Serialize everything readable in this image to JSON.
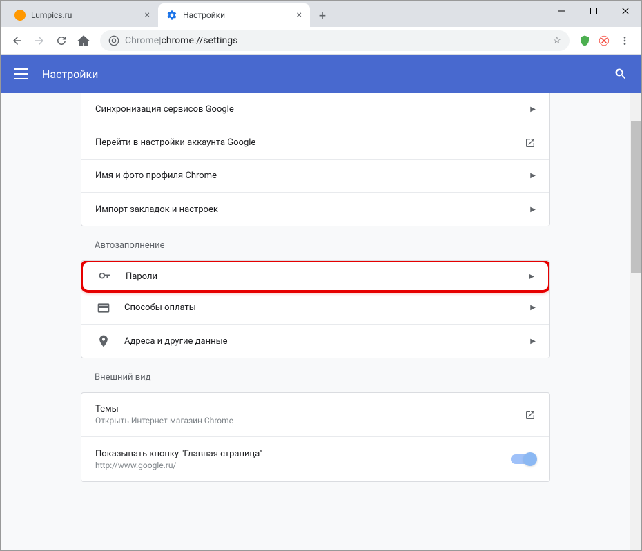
{
  "window": {
    "tabs": [
      {
        "title": "Lumpics.ru",
        "active": false
      },
      {
        "title": "Настройки",
        "active": true
      }
    ]
  },
  "toolbar": {
    "url_prefix": "Chrome",
    "url_separator": " | ",
    "url_path": "chrome://settings"
  },
  "header": {
    "title": "Настройки"
  },
  "sections": {
    "sync": {
      "rows": [
        {
          "label": "Синхронизация сервисов Google"
        },
        {
          "label": "Перейти в настройки аккаунта Google"
        },
        {
          "label": "Имя и фото профиля Chrome"
        },
        {
          "label": "Импорт закладок и настроек"
        }
      ]
    },
    "autofill": {
      "title": "Автозаполнение",
      "rows": [
        {
          "label": "Пароли"
        },
        {
          "label": "Способы оплаты"
        },
        {
          "label": "Адреса и другие данные"
        }
      ]
    },
    "appearance": {
      "title": "Внешний вид",
      "themes": {
        "label": "Темы",
        "sublabel": "Открыть Интернет-магазин Chrome"
      },
      "homebtn": {
        "label": "Показывать кнопку \"Главная страница\"",
        "sublabel": "http://www.google.ru/"
      }
    }
  }
}
